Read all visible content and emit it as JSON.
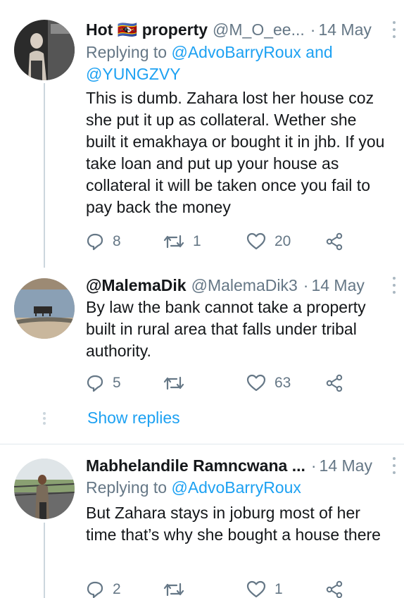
{
  "tweets": [
    {
      "name": "Hot 🇸🇿 property",
      "handle": "@M_O_ee...",
      "date": "14 May",
      "replying_prefix": "Replying to ",
      "replying_targets": "@AdvoBarryRoux and @YUNGZVY",
      "text": "This is dumb. Zahara lost her house coz she put it up as collateral. Wether she built it emakhaya or bought it in jhb. If you take loan and put up your house as collateral it will be taken once you fail to pay back the money",
      "replies": "8",
      "retweets": "1",
      "likes": "20"
    },
    {
      "name": "@MalemaDik",
      "handle": "@MalemaDik3",
      "date": "14 May",
      "text": "By law the bank cannot take a property built in rural area that falls under tribal authority.",
      "replies": "5",
      "retweets": "",
      "likes": "63"
    },
    {
      "name": "Mabhelandile Ramncwana ...",
      "handle": "",
      "date": "14 May",
      "replying_prefix": "Replying to ",
      "replying_targets": "@AdvoBarryRoux",
      "text": "But Zahara stays in joburg most of her time that’s why she bought a house there",
      "replies": "2",
      "retweets": "",
      "likes": "1"
    }
  ],
  "show_replies": "Show replies",
  "icons": [
    "reply-icon",
    "retweet-icon",
    "like-icon",
    "share-icon",
    "more-icon"
  ],
  "colors": {
    "link": "#1da1f2",
    "secondary": "#657786",
    "text": "#14171a",
    "thread": "#ccd6dd"
  }
}
